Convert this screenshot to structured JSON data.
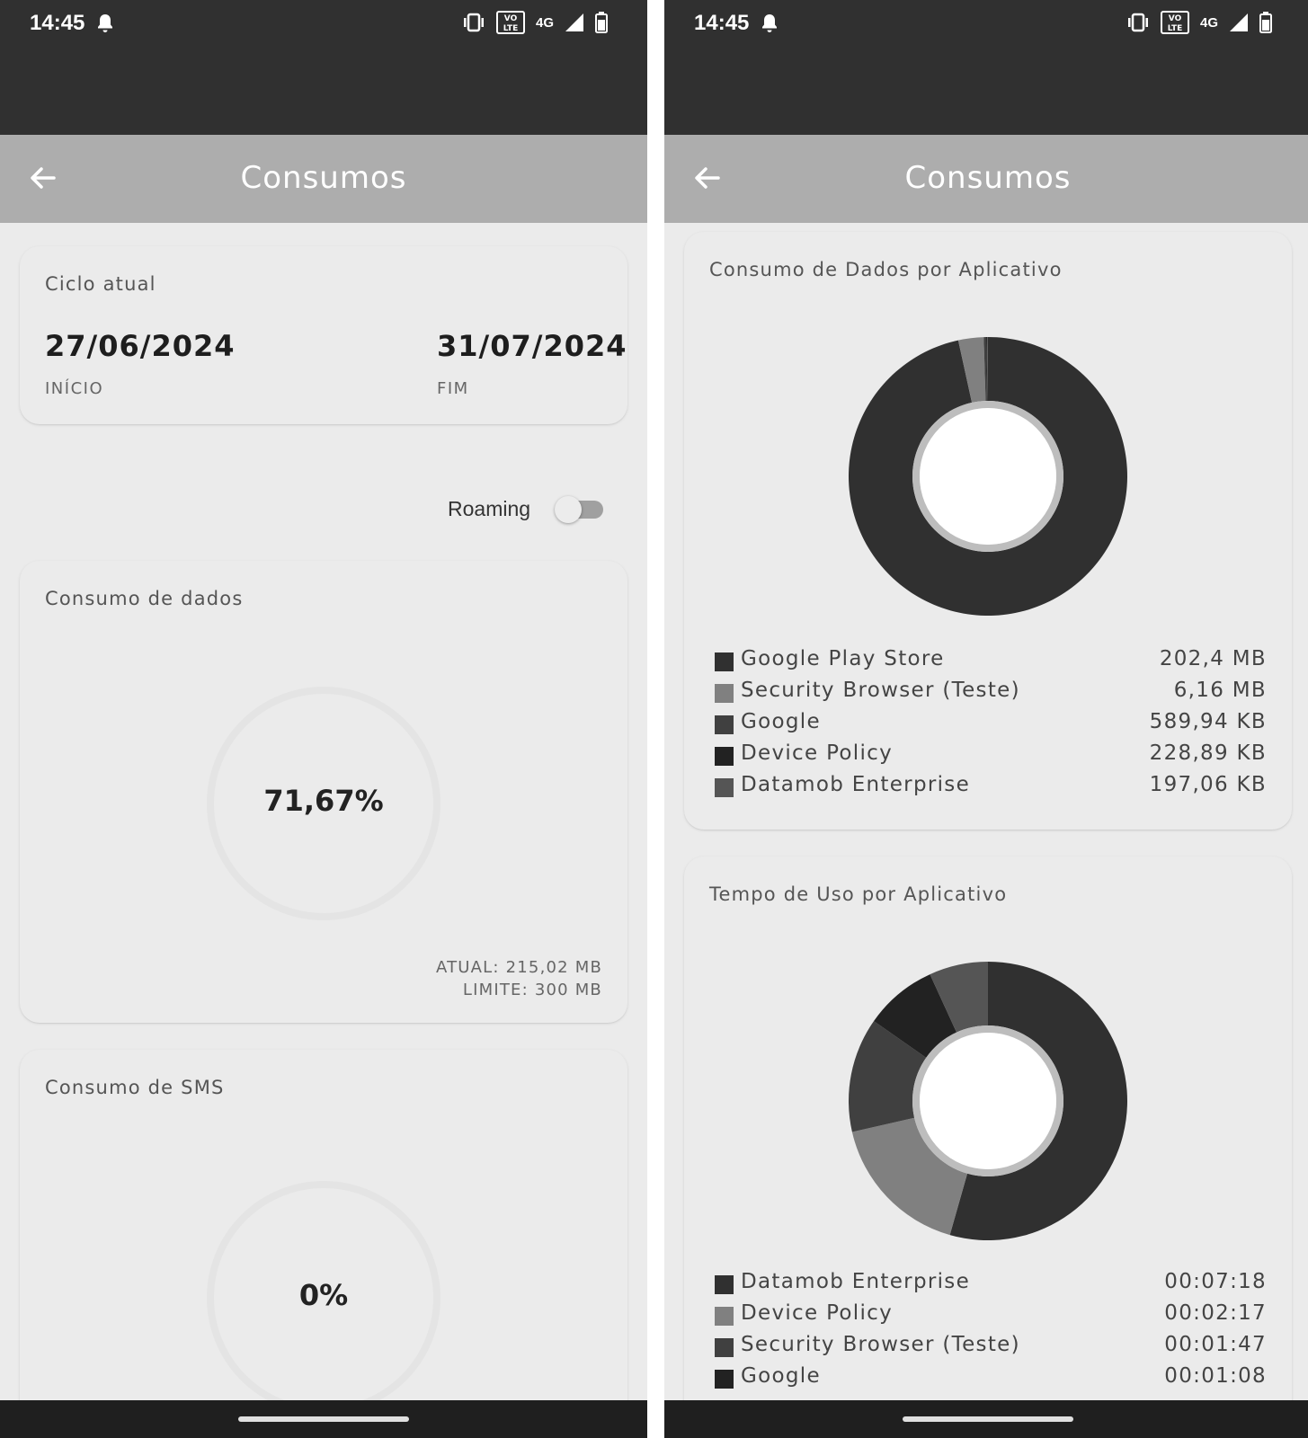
{
  "status_bar": {
    "time": "14:45",
    "network": "4G",
    "volte": "VO LTE"
  },
  "app_bar": {
    "title": "Consumos"
  },
  "ciclo": {
    "title": "Ciclo atual",
    "start_date": "27/06/2024",
    "start_caption": "INÍCIO",
    "end_date": "31/07/2024",
    "end_caption": "FIM"
  },
  "roaming": {
    "label": "Roaming",
    "enabled": false
  },
  "dados": {
    "title": "Consumo de dados",
    "percent_label": "71,67%",
    "percent": 71.67,
    "atual_label": "ATUAL:",
    "atual_value": "215,02 MB",
    "limite_label": "LIMITE:",
    "limite_value": "300 MB"
  },
  "sms": {
    "title": "Consumo de SMS",
    "percent_label": "0%",
    "percent": 0
  },
  "colors": {
    "status_bar": "#303030",
    "app_bar": "#adadad",
    "background": "#ebebeb",
    "chart_dark": "#303030",
    "chart_mid": "#808080",
    "chart_gray": "#404040",
    "chart_black": "#222222",
    "chart_slate": "#555555"
  },
  "chart_data": [
    {
      "type": "pie",
      "title": "Consumo de Dados por Aplicativo",
      "categories": [
        "Google Play Store",
        "Security Browser (Teste)",
        "Google",
        "Device Policy",
        "Datamob Enterprise"
      ],
      "value_labels": [
        "202,4 MB",
        "6,16 MB",
        "589,94 KB",
        "228,89 KB",
        "197,06 KB"
      ],
      "values": [
        202.4,
        6.16,
        0.59,
        0.229,
        0.197
      ],
      "unit": "MB",
      "colors": [
        "#303030",
        "#808080",
        "#404040",
        "#222222",
        "#555555"
      ],
      "legend": "bottom"
    },
    {
      "type": "pie",
      "title": "Tempo de Uso por Aplicativo",
      "categories": [
        "Datamob Enterprise",
        "Device Policy",
        "Security Browser (Teste)",
        "Google"
      ],
      "value_labels": [
        "00:07:18",
        "00:02:17",
        "00:01:47",
        "00:01:08"
      ],
      "values": [
        438,
        137,
        107,
        68,
        55
      ],
      "unit": "s",
      "colors": [
        "#303030",
        "#808080",
        "#404040",
        "#222222",
        "#555555"
      ],
      "legend": "bottom"
    }
  ]
}
